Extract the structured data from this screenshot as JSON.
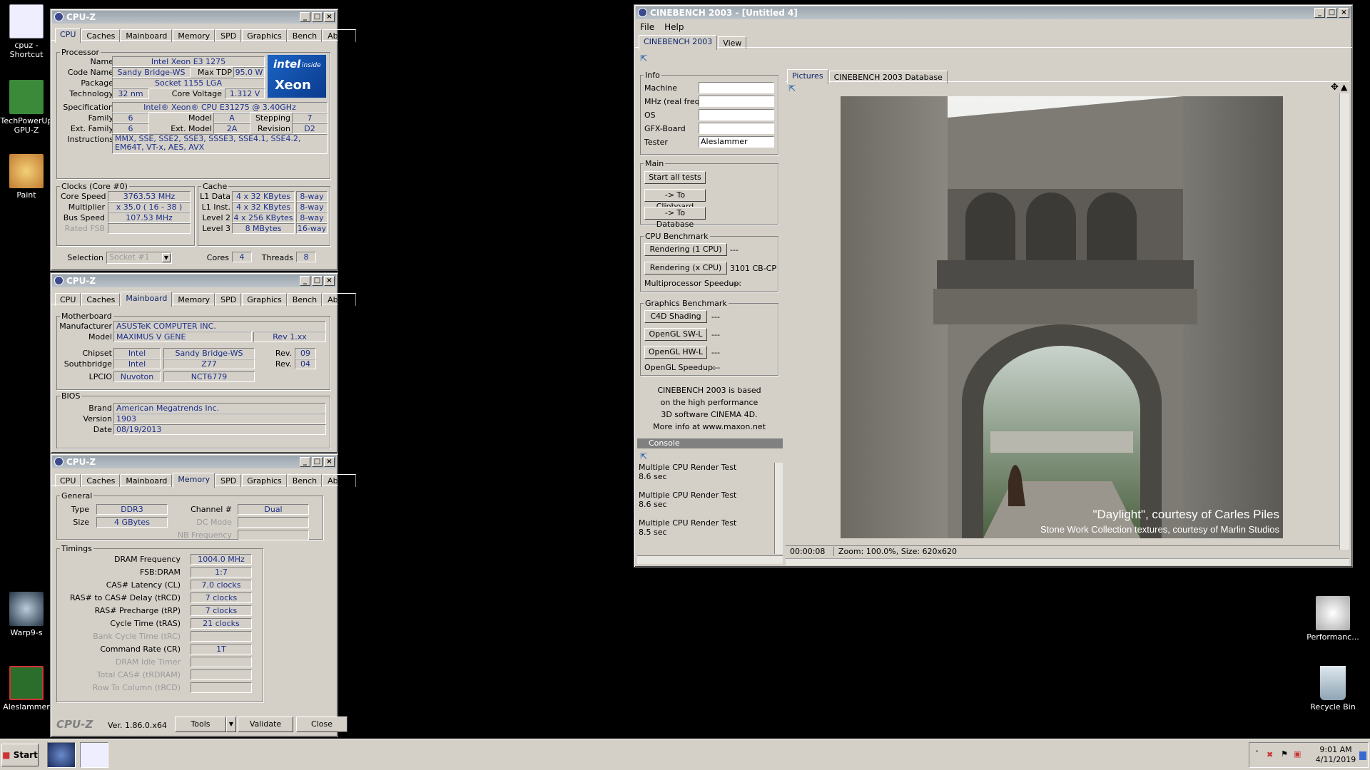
{
  "desktop_icons": [
    {
      "label": "cpuz - Shortcut"
    },
    {
      "label": "TechPowerUp GPU-Z"
    },
    {
      "label": "Paint"
    },
    {
      "label": "Warp9-s"
    },
    {
      "label": "Aleslammer"
    },
    {
      "label": "Performanc..."
    },
    {
      "label": "Recycle Bin"
    }
  ],
  "tabs": [
    "CPU",
    "Caches",
    "Mainboard",
    "Memory",
    "SPD",
    "Graphics",
    "Bench",
    "About"
  ],
  "cpuz_title": "CPU-Z",
  "cpu": {
    "processor_legend": "Processor",
    "name_label": "Name",
    "name": "Intel Xeon E3 1275",
    "codename_label": "Code Name",
    "codename": "Sandy Bridge-WS",
    "tdp_label": "Max TDP",
    "tdp": "95.0 W",
    "package_label": "Package",
    "package": "Socket 1155 LGA",
    "tech_label": "Technology",
    "tech": "32 nm",
    "voltage_label": "Core Voltage",
    "voltage": "1.312 V",
    "spec_label": "Specification",
    "spec": "Intel® Xeon® CPU E31275 @ 3.40GHz",
    "family_label": "Family",
    "family": "6",
    "model_label": "Model",
    "model": "A",
    "stepping_label": "Stepping",
    "stepping": "7",
    "extfamily_label": "Ext. Family",
    "extfamily": "6",
    "extmodel_label": "Ext. Model",
    "extmodel": "2A",
    "revision_label": "Revision",
    "revision": "D2",
    "instr_label": "Instructions",
    "instructions": "MMX, SSE, SSE2, SSE3, SSSE3, SSE4.1, SSE4.2, EM64T, VT-x, AES, AVX",
    "clocks_legend": "Clocks (Core #0)",
    "corespeed_label": "Core Speed",
    "corespeed": "3763.53 MHz",
    "mult_label": "Multiplier",
    "mult": "x 35.0 ( 16 - 38 )",
    "bus_label": "Bus Speed",
    "bus": "107.53 MHz",
    "fsb_label": "Rated FSB",
    "cache_legend": "Cache",
    "l1d_label": "L1 Data",
    "l1d": "4 x 32 KBytes",
    "l1d_way": "8-way",
    "l1i_label": "L1 Inst.",
    "l1i": "4 x 32 KBytes",
    "l1i_way": "8-way",
    "l2_label": "Level 2",
    "l2": "4 x 256 KBytes",
    "l2_way": "8-way",
    "l3_label": "Level 3",
    "l3": "8 MBytes",
    "l3_way": "16-way",
    "selection_label": "Selection",
    "selection": "Socket #1",
    "cores_label": "Cores",
    "cores": "4",
    "threads_label": "Threads",
    "threads": "8",
    "logo_top": "intel",
    "logo_inside": "inside",
    "logo_brand": "Xeon"
  },
  "mainboard": {
    "legend": "Motherboard",
    "manu_label": "Manufacturer",
    "manu": "ASUSTeK COMPUTER INC.",
    "model_label": "Model",
    "model": "MAXIMUS V GENE",
    "rev": "Rev 1.xx",
    "chipset_label": "Chipset",
    "chipset_vendor": "Intel",
    "chipset": "Sandy Bridge-WS",
    "chipset_rev_label": "Rev.",
    "chipset_rev": "09",
    "south_label": "Southbridge",
    "south_vendor": "Intel",
    "south": "Z77",
    "south_rev_label": "Rev.",
    "south_rev": "04",
    "lpcio_label": "LPCIO",
    "lpcio_vendor": "Nuvoton",
    "lpcio": "NCT6779",
    "bios_legend": "BIOS",
    "brand_label": "Brand",
    "brand": "American Megatrends Inc.",
    "version_label": "Version",
    "version": "1903",
    "date_label": "Date",
    "date": "08/19/2013"
  },
  "memory": {
    "general_legend": "General",
    "type_label": "Type",
    "type": "DDR3",
    "channel_label": "Channel #",
    "channel": "Dual",
    "size_label": "Size",
    "size": "4 GBytes",
    "dcmode_label": "DC Mode",
    "nbfreq_label": "NB Frequency",
    "timings_legend": "Timings",
    "rows": [
      {
        "label": "DRAM Frequency",
        "value": "1004.0 MHz",
        "enabled": true
      },
      {
        "label": "FSB:DRAM",
        "value": "1:7",
        "enabled": true
      },
      {
        "label": "CAS# Latency (CL)",
        "value": "7.0 clocks",
        "enabled": true
      },
      {
        "label": "RAS# to CAS# Delay (tRCD)",
        "value": "7 clocks",
        "enabled": true
      },
      {
        "label": "RAS# Precharge (tRP)",
        "value": "7 clocks",
        "enabled": true
      },
      {
        "label": "Cycle Time (tRAS)",
        "value": "21 clocks",
        "enabled": true
      },
      {
        "label": "Bank Cycle Time (tRC)",
        "value": "",
        "enabled": false
      },
      {
        "label": "Command Rate (CR)",
        "value": "1T",
        "enabled": true
      },
      {
        "label": "DRAM Idle Timer",
        "value": "",
        "enabled": false
      },
      {
        "label": "Total CAS# (tRDRAM)",
        "value": "",
        "enabled": false
      },
      {
        "label": "Row To Column (tRCD)",
        "value": "",
        "enabled": false
      }
    ],
    "brand": "CPU-Z",
    "version": "Ver. 1.86.0.x64",
    "tools": "Tools",
    "validate": "Validate",
    "close": "Close"
  },
  "cinebench": {
    "title": "CINEBENCH 2003 - [Untitled 4]",
    "menu": [
      "File",
      "Help"
    ],
    "tabs": [
      "CINEBENCH 2003",
      "View"
    ],
    "info_legend": "Info",
    "machine_label": "Machine",
    "mhz_label": "MHz (real freq.)",
    "os_label": "OS",
    "gfx_label": "GFX-Board",
    "tester_label": "Tester",
    "tester": "Aleslammer",
    "main_legend": "Main",
    "start_all": "Start all tests",
    "to_clipboard": "-> To Clipboard",
    "to_database": "-> To Database",
    "cpu_legend": "CPU Benchmark",
    "render1": "Rendering (1 CPU)",
    "render1_val": "---",
    "renderx": "Rendering (x CPU)",
    "renderx_val": "3101 CB-CPU",
    "mp_label": "Multiprocessor Speedup:",
    "mp_val": "---",
    "gfx_legend": "Graphics Benchmark",
    "c4d": "C4D Shading",
    "c4d_val": "---",
    "swl": "OpenGL SW-L",
    "swl_val": "---",
    "hwl": "OpenGL HW-L",
    "hwl_val": "---",
    "ogl_label": "OpenGL Speedup:",
    "ogl_val": "---",
    "about_lines": [
      "CINEBENCH 2003 is based",
      "on the high performance",
      "3D software CINEMA 4D.",
      "More info at www.maxon.net"
    ],
    "console_title": "Console",
    "console": [
      {
        "line1": "Multiple CPU Render Test",
        "line2": "8.6 sec"
      },
      {
        "line1": "Multiple CPU Render Test",
        "line2": "8.6 sec"
      },
      {
        "line1": "Multiple CPU Render Test",
        "line2": "8.5 sec"
      }
    ],
    "right_tabs": [
      "Pictures",
      "CINEBENCH 2003 Database"
    ],
    "caption1": "\"Daylight\", courtesy of Carles Piles",
    "caption2": "Stone Work Collection textures, courtesy of Marlin Studios",
    "status": "00:00:08",
    "status2": "Zoom: 100.0%, Size: 620x620"
  },
  "taskbar": {
    "start": "Start",
    "time": "9:01 AM",
    "date": "4/11/2019"
  }
}
